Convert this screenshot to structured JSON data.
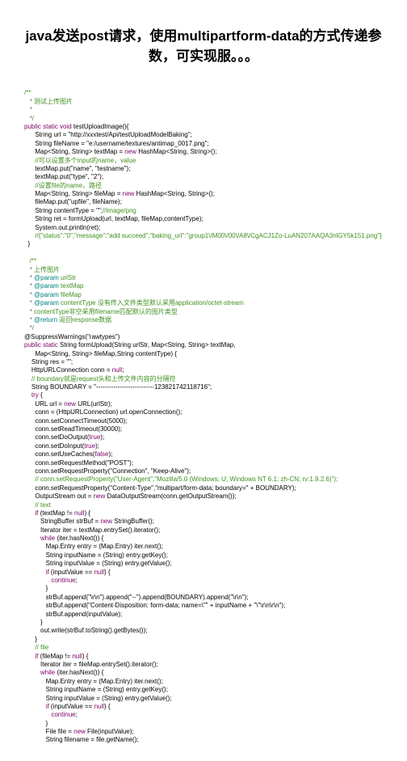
{
  "title": "java发送post请求，使用multipartform-data的方式传递参数，可实现服。。。",
  "line1": "/**",
  "line2": "   * 测试上传图片",
  "line3": "   *",
  "line4": "   */",
  "kw_psv": "public static void",
  "meth_test": " testUploadImage(){",
  "l_url": "      String url = \"http://xxxtest/Api/testUploadModelBaking\";",
  "l_fn": "      String fileName = \"e:/username/textures/antimap_0017.png\";",
  "l_map1": "      Map<String, String> textMap = ",
  "kw_new": "new",
  "l_map1b": " HashMap<String, String>();",
  "com_multi": "      //可以设置多个input的name，value",
  "l_put1": "      textMap.put(\"name\", \"testname\");",
  "l_put2": "      textMap.put(\"type\", \"2\");",
  "com_filelab": "      //设置file的name，路径",
  "l_fmap": "      Map<String, String> fileMap = ",
  "l_fmapb": " HashMap<String, String>();",
  "l_fput": "      fileMap.put(\"upfile\", fileName);",
  "l_ctype": "      String contentType = \"\";",
  "com_imgpng": "//image/png",
  "l_ret": "      String ret = formUpload(url, textMap, fileMap,contentType);",
  "l_sout": "      System.out.println(ret);",
  "com_resp": "      //{\"status\":\"0\",\"message\":\"add succeed\",\"baking_url\":\"group1\\/M00\\/00\\/A8\\/CgACJ1Zo-LuAN207AAQA3nlGY5k151.png\"}",
  "close1": "  }",
  "doc_start": "   /**",
  "doc_up": "   * 上传图片",
  "doc_url": "   * @param urlStr",
  "doc_tm": "   * @param textMap",
  "doc_fm": "   * @param fileMap",
  "doc_ct": "   * @param contentType 没有传入文件类型默认采用application/octet-stream",
  "doc_ct2": "   * contentType非空采用filename匹配默认的图片类型",
  "doc_ret": "   * @return 返回response数据",
  "doc_end": "   */",
  "supwarn": "@SuppressWarnings(\"rawtypes\")",
  "kw_ps": "public static",
  "meth_fu": " String formUpload(String urlStr, Map<String, String> textMap,",
  "meth_fu2": "      Map<String, String> fileMap,String contentType) {",
  "l_res": "    String res = \"\";",
  "l_conn": "    HttpURLConnection conn = ",
  "kw_null": "null",
  "semi": ";",
  "com_bound": "    // boundary就是request头和上传文件内容的分隔符",
  "l_bound": "    String BOUNDARY = \"---------------------------123821742118716\";",
  "kw_try": "try",
  "brace": " {",
  "l_urlobj": "      URL url = ",
  "l_urlb": " URL(urlStr);",
  "l_openc": "      conn = (HttpURLConnection) url.openConnection();",
  "l_ct5000": "      conn.setConnectTimeout(5000);",
  "l_rt30000": "      conn.setReadTimeout(30000);",
  "l_doout": "      conn.setDoOutput(",
  "kw_true": "true",
  "l_doin": "      conn.setDoInput(",
  "l_caches": "      conn.setUseCaches(",
  "kw_false": "false",
  "l_post": "      conn.setRequestMethod(\"POST\");",
  "l_ka": "      conn.setRequestProperty(\"Connection\", \"Keep-Alive\");",
  "l_ua": "      // conn.setRequestProperty(\"User-Agent\",\"Mozilla/5.0 (Windows; U; Windows NT 6.1; zh-CN; rv:1.9.2.6)\");",
  "l_ctmp": "      conn.setRequestProperty(\"Content-Type\",\"multipart/form-data; boundary=\" + BOUNDARY);",
  "l_os": "      OutputStream out = ",
  "l_osb": " DataOutputStream(conn.getOutputStream());",
  "com_text": "      // text",
  "kw_if": "if",
  "cond_tm": " (textMap != ",
  "l_sb": "         StringBuffer strBuf = ",
  "l_sbb": " StringBuffer();",
  "l_iter": "         Iterator iter = textMap.entrySet().iterator();",
  "kw_while": "while",
  "cond_hn": " (iter.hasNext()) {",
  "l_me": "            Map.Entry entry = (Map.Entry) iter.next();",
  "l_in": "            String inputName = (String) entry.getKey();",
  "l_iv": "            String inputValue = (String) entry.getValue();",
  "cond_ivn": " (inputValue == ",
  "cond_ivnb": ") {",
  "kw_cont": "continue",
  "brclose": "            }",
  "l_app1": "            strBuf.append(\"\\r\\n\").append(\"--\").append(BOUNDARY).append(\"\\r\\n\");",
  "l_app2": "            strBuf.append(\"Content-Disposition: form-data; name=\\\"\" + inputName + \"\\\"\\r\\n\\r\\n\");",
  "l_app3": "            strBuf.append(inputValue);",
  "brc2": "         }",
  "l_owrite": "         out.write(strBuf.toString().getBytes());",
  "brc3": "      }",
  "com_file": "      // file",
  "cond_fm": " (fileMap != ",
  "l_fiter": "         Iterator iter = fileMap.entrySet().iterator();",
  "l_ffile": "            File file = ",
  "l_ffileb": " File(inputValue);",
  "l_fname": "            String filename = file.getName();"
}
